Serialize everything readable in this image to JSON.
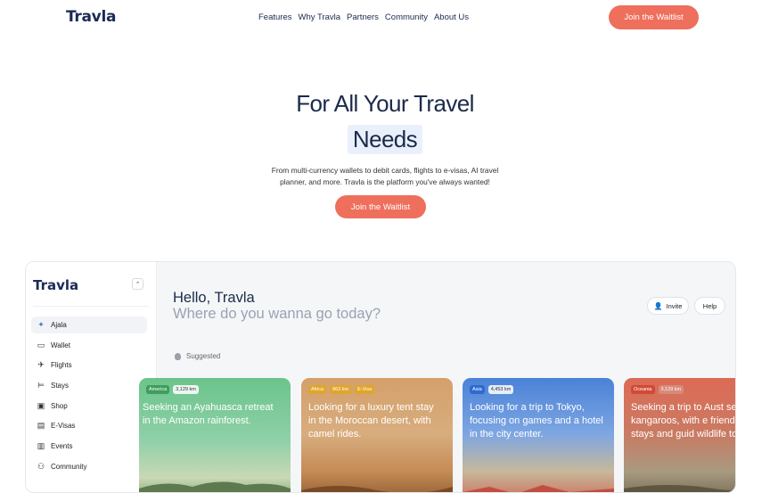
{
  "nav": {
    "logo": "Travla",
    "links": [
      "Features",
      "Why Travla",
      "Partners",
      "Community",
      "About Us"
    ],
    "cta": "Join the Waitlist"
  },
  "hero": {
    "title_line1": "For All Your Travel",
    "title_line2": "Needs",
    "subtitle_line1": "From multi-currency wallets to debit cards, flights to e-visas, AI travel",
    "subtitle_line2": "planner, and more. Travla is the platform you've always wanted!",
    "cta": "Join the Waitlist"
  },
  "app": {
    "logo": "Travla",
    "sidebar": [
      {
        "label": "Ajala",
        "icon": "sparkle-icon",
        "glyph": "✦"
      },
      {
        "label": "Wallet",
        "icon": "wallet-icon",
        "glyph": "▭"
      },
      {
        "label": "Flights",
        "icon": "airplane-icon",
        "glyph": "✈"
      },
      {
        "label": "Stays",
        "icon": "bed-icon",
        "glyph": "⊨"
      },
      {
        "label": "Shop",
        "icon": "bag-icon",
        "glyph": "▣"
      },
      {
        "label": "E-Visas",
        "icon": "document-icon",
        "glyph": "▤"
      },
      {
        "label": "Events",
        "icon": "ticket-icon",
        "glyph": "▥"
      },
      {
        "label": "Community",
        "icon": "people-icon",
        "glyph": "⚇"
      }
    ],
    "greeting": "Hello, Travla",
    "greeting_sub": "Where do you wanna go today?",
    "invite": "Invite",
    "help": "Help",
    "suggested": "Suggested",
    "cards": [
      {
        "region": "America",
        "distance": "3,129 km",
        "text": "Seeking an Ayahuasca retreat in the Amazon rainforest.",
        "visible_text": "eking an Ayahuasca treat in the Amazon nforest."
      },
      {
        "region": "Africa",
        "distance": "863 km",
        "extra": "E-Visa",
        "text": "Looking for a luxury tent stay in the Moroccan desert, with camel rides."
      },
      {
        "region": "Asia",
        "distance": "4,453 km",
        "text": "Looking for a trip to Tokyo, focusing on games and a hotel in the city center."
      },
      {
        "region": "Oceania",
        "distance": "3,129 km",
        "text": "Seeking a trip to Aust see kangaroos, with e friendly stays and guid wildlife tours."
      }
    ]
  },
  "colors": {
    "accent": "#ee6f5c",
    "navy": "#1b2b4a"
  }
}
